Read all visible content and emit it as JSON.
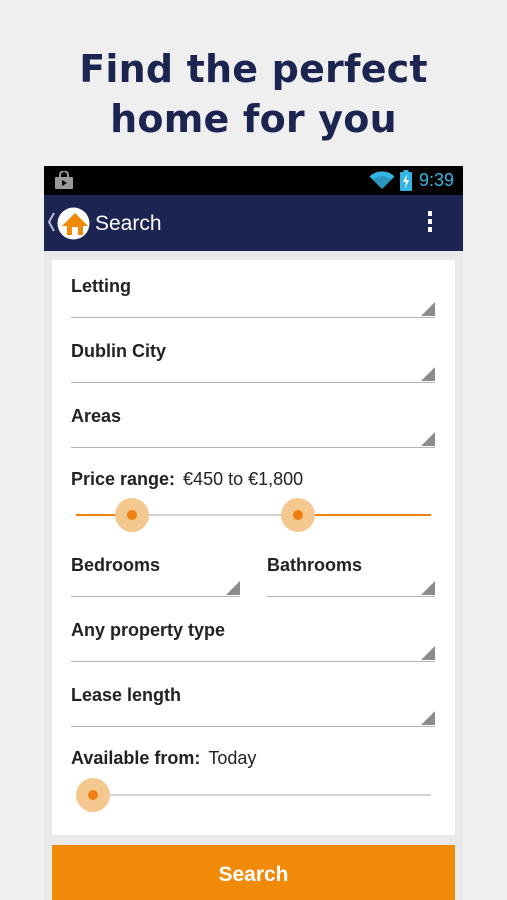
{
  "headline": {
    "line1": "Find the perfect",
    "line2": "home for you"
  },
  "status_bar": {
    "time": "9:39",
    "accent_color": "#33b5e5",
    "icons": [
      "shopping-bag-icon",
      "wifi-icon",
      "battery-charging-icon"
    ]
  },
  "app_bar": {
    "title": "Search",
    "background": "#1c2452",
    "icons": [
      "back-chevron-icon",
      "app-logo-house-icon",
      "overflow-menu-icon"
    ]
  },
  "form": {
    "listing_type": "Letting",
    "location": "Dublin City",
    "areas": "Areas",
    "price_range": {
      "label": "Price range:",
      "value": "€450 to €1,800",
      "min_fraction": 0.12,
      "max_fraction": 0.64
    },
    "bedrooms": "Bedrooms",
    "bathrooms": "Bathrooms",
    "property_type": "Any property type",
    "lease_length": "Lease length",
    "available_from": {
      "label": "Available from:",
      "value": "Today",
      "fraction": 0.0
    }
  },
  "search_button": {
    "label": "Search",
    "color": "#f08a08"
  },
  "accent_color": "#ef7f10"
}
